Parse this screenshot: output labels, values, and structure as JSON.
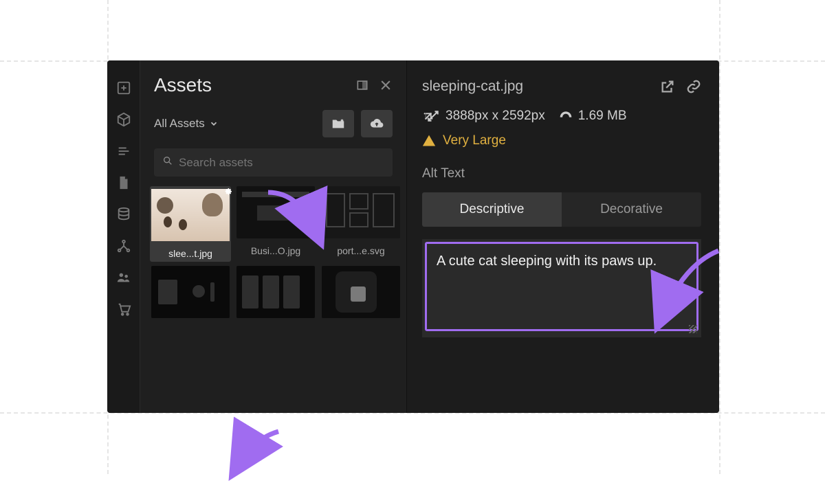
{
  "assets_panel": {
    "title": "Assets",
    "folder_selector": "All Assets",
    "search_placeholder": "Search assets",
    "items": [
      {
        "filename_short": "slee...t.jpg"
      },
      {
        "filename_short": "Busi...O.jpg"
      },
      {
        "filename_short": "port...e.svg"
      }
    ]
  },
  "detail": {
    "filename": "sleeping-cat.jpg",
    "dimensions": "3888px x 2592px",
    "filesize": "1.69 MB",
    "size_warning": "Very Large",
    "alt_text_label": "Alt Text",
    "tabs": {
      "descriptive": "Descriptive",
      "decorative": "Decorative"
    },
    "alt_text_value": "A cute cat sleeping with its paws up."
  },
  "colors": {
    "accent_purple": "#a06cf0",
    "warning": "#e0b040"
  }
}
